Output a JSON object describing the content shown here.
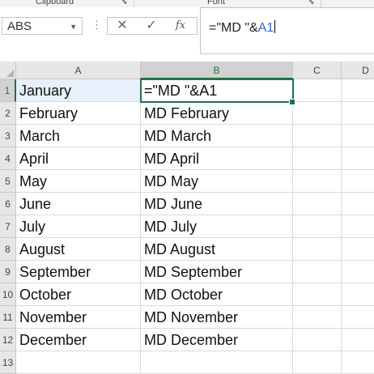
{
  "ribbon": {
    "groups": [
      {
        "label": "Clipboard"
      },
      {
        "label": "Font"
      }
    ]
  },
  "name_box": {
    "value": "ABS"
  },
  "formula_bar": {
    "buttons": {
      "cancel": "✕",
      "enter": "✓",
      "insert_function": "fx"
    },
    "formula_prefix": "=\"MD \"&",
    "formula_ref": "A1"
  },
  "columns": [
    "A",
    "B",
    "C",
    "D"
  ],
  "active_cell": "B1",
  "rows": [
    {
      "num": "1",
      "a": "January",
      "b": "=\"MD \"&A1"
    },
    {
      "num": "2",
      "a": "February",
      "b": "MD February"
    },
    {
      "num": "3",
      "a": "March",
      "b": "MD March"
    },
    {
      "num": "4",
      "a": "April",
      "b": "MD April"
    },
    {
      "num": "5",
      "a": "May",
      "b": "MD May"
    },
    {
      "num": "6",
      "a": "June",
      "b": "MD June"
    },
    {
      "num": "7",
      "a": "July",
      "b": "MD July"
    },
    {
      "num": "8",
      "a": "August",
      "b": "MD August"
    },
    {
      "num": "9",
      "a": "September",
      "b": "MD September"
    },
    {
      "num": "10",
      "a": "October",
      "b": "MD October"
    },
    {
      "num": "11",
      "a": "November",
      "b": "MD November"
    },
    {
      "num": "12",
      "a": "December",
      "b": "MD December"
    },
    {
      "num": "13",
      "a": "",
      "b": ""
    }
  ]
}
